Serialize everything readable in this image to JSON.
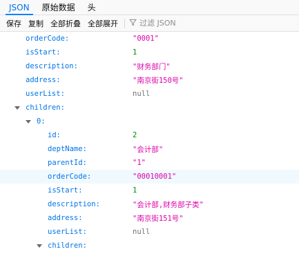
{
  "tabs": [
    {
      "label": "JSON"
    },
    {
      "label": "原始数据"
    },
    {
      "label": "头"
    }
  ],
  "toolbar": {
    "save": "保存",
    "copy": "复制",
    "collapse_all": "全部折叠",
    "expand_all": "全部展开",
    "filter_placeholder": "过滤 JSON"
  },
  "rows": [
    {
      "key": "orderCode:",
      "value": "\"0001\"",
      "type": "string",
      "depth": 0
    },
    {
      "key": "isStart:",
      "value": "1",
      "type": "number",
      "depth": 0
    },
    {
      "key": "description:",
      "value": "\"财务部门\"",
      "type": "string",
      "depth": 0
    },
    {
      "key": "address:",
      "value": "\"南京街150号\"",
      "type": "string",
      "depth": 0
    },
    {
      "key": "userList:",
      "value": "null",
      "type": "null",
      "depth": 0
    },
    {
      "key": "children:",
      "value": "",
      "type": "expander",
      "depth": 0
    },
    {
      "key": "0:",
      "value": "",
      "type": "expander",
      "depth": 1
    },
    {
      "key": "id:",
      "value": "2",
      "type": "number",
      "depth": 2
    },
    {
      "key": "deptName:",
      "value": "\"会计部\"",
      "type": "string",
      "depth": 2
    },
    {
      "key": "parentId:",
      "value": "\"1\"",
      "type": "string",
      "depth": 2
    },
    {
      "key": "orderCode:",
      "value": "\"00010001\"",
      "type": "string",
      "depth": 2
    },
    {
      "key": "isStart:",
      "value": "1",
      "type": "number",
      "depth": 2
    },
    {
      "key": "description:",
      "value": "\"会计部,财务部子类\"",
      "type": "string",
      "depth": 2
    },
    {
      "key": "address:",
      "value": "\"南京街151号\"",
      "type": "string",
      "depth": 2
    },
    {
      "key": "userList:",
      "value": "null",
      "type": "null",
      "depth": 2
    },
    {
      "key": "children:",
      "value": "",
      "type": "expander",
      "depth": 2
    }
  ],
  "colors": {
    "key": "#0074e8",
    "string": "#dd00a9",
    "number": "#058b00",
    "null": "#737373",
    "active_tab": "#0074e8"
  }
}
